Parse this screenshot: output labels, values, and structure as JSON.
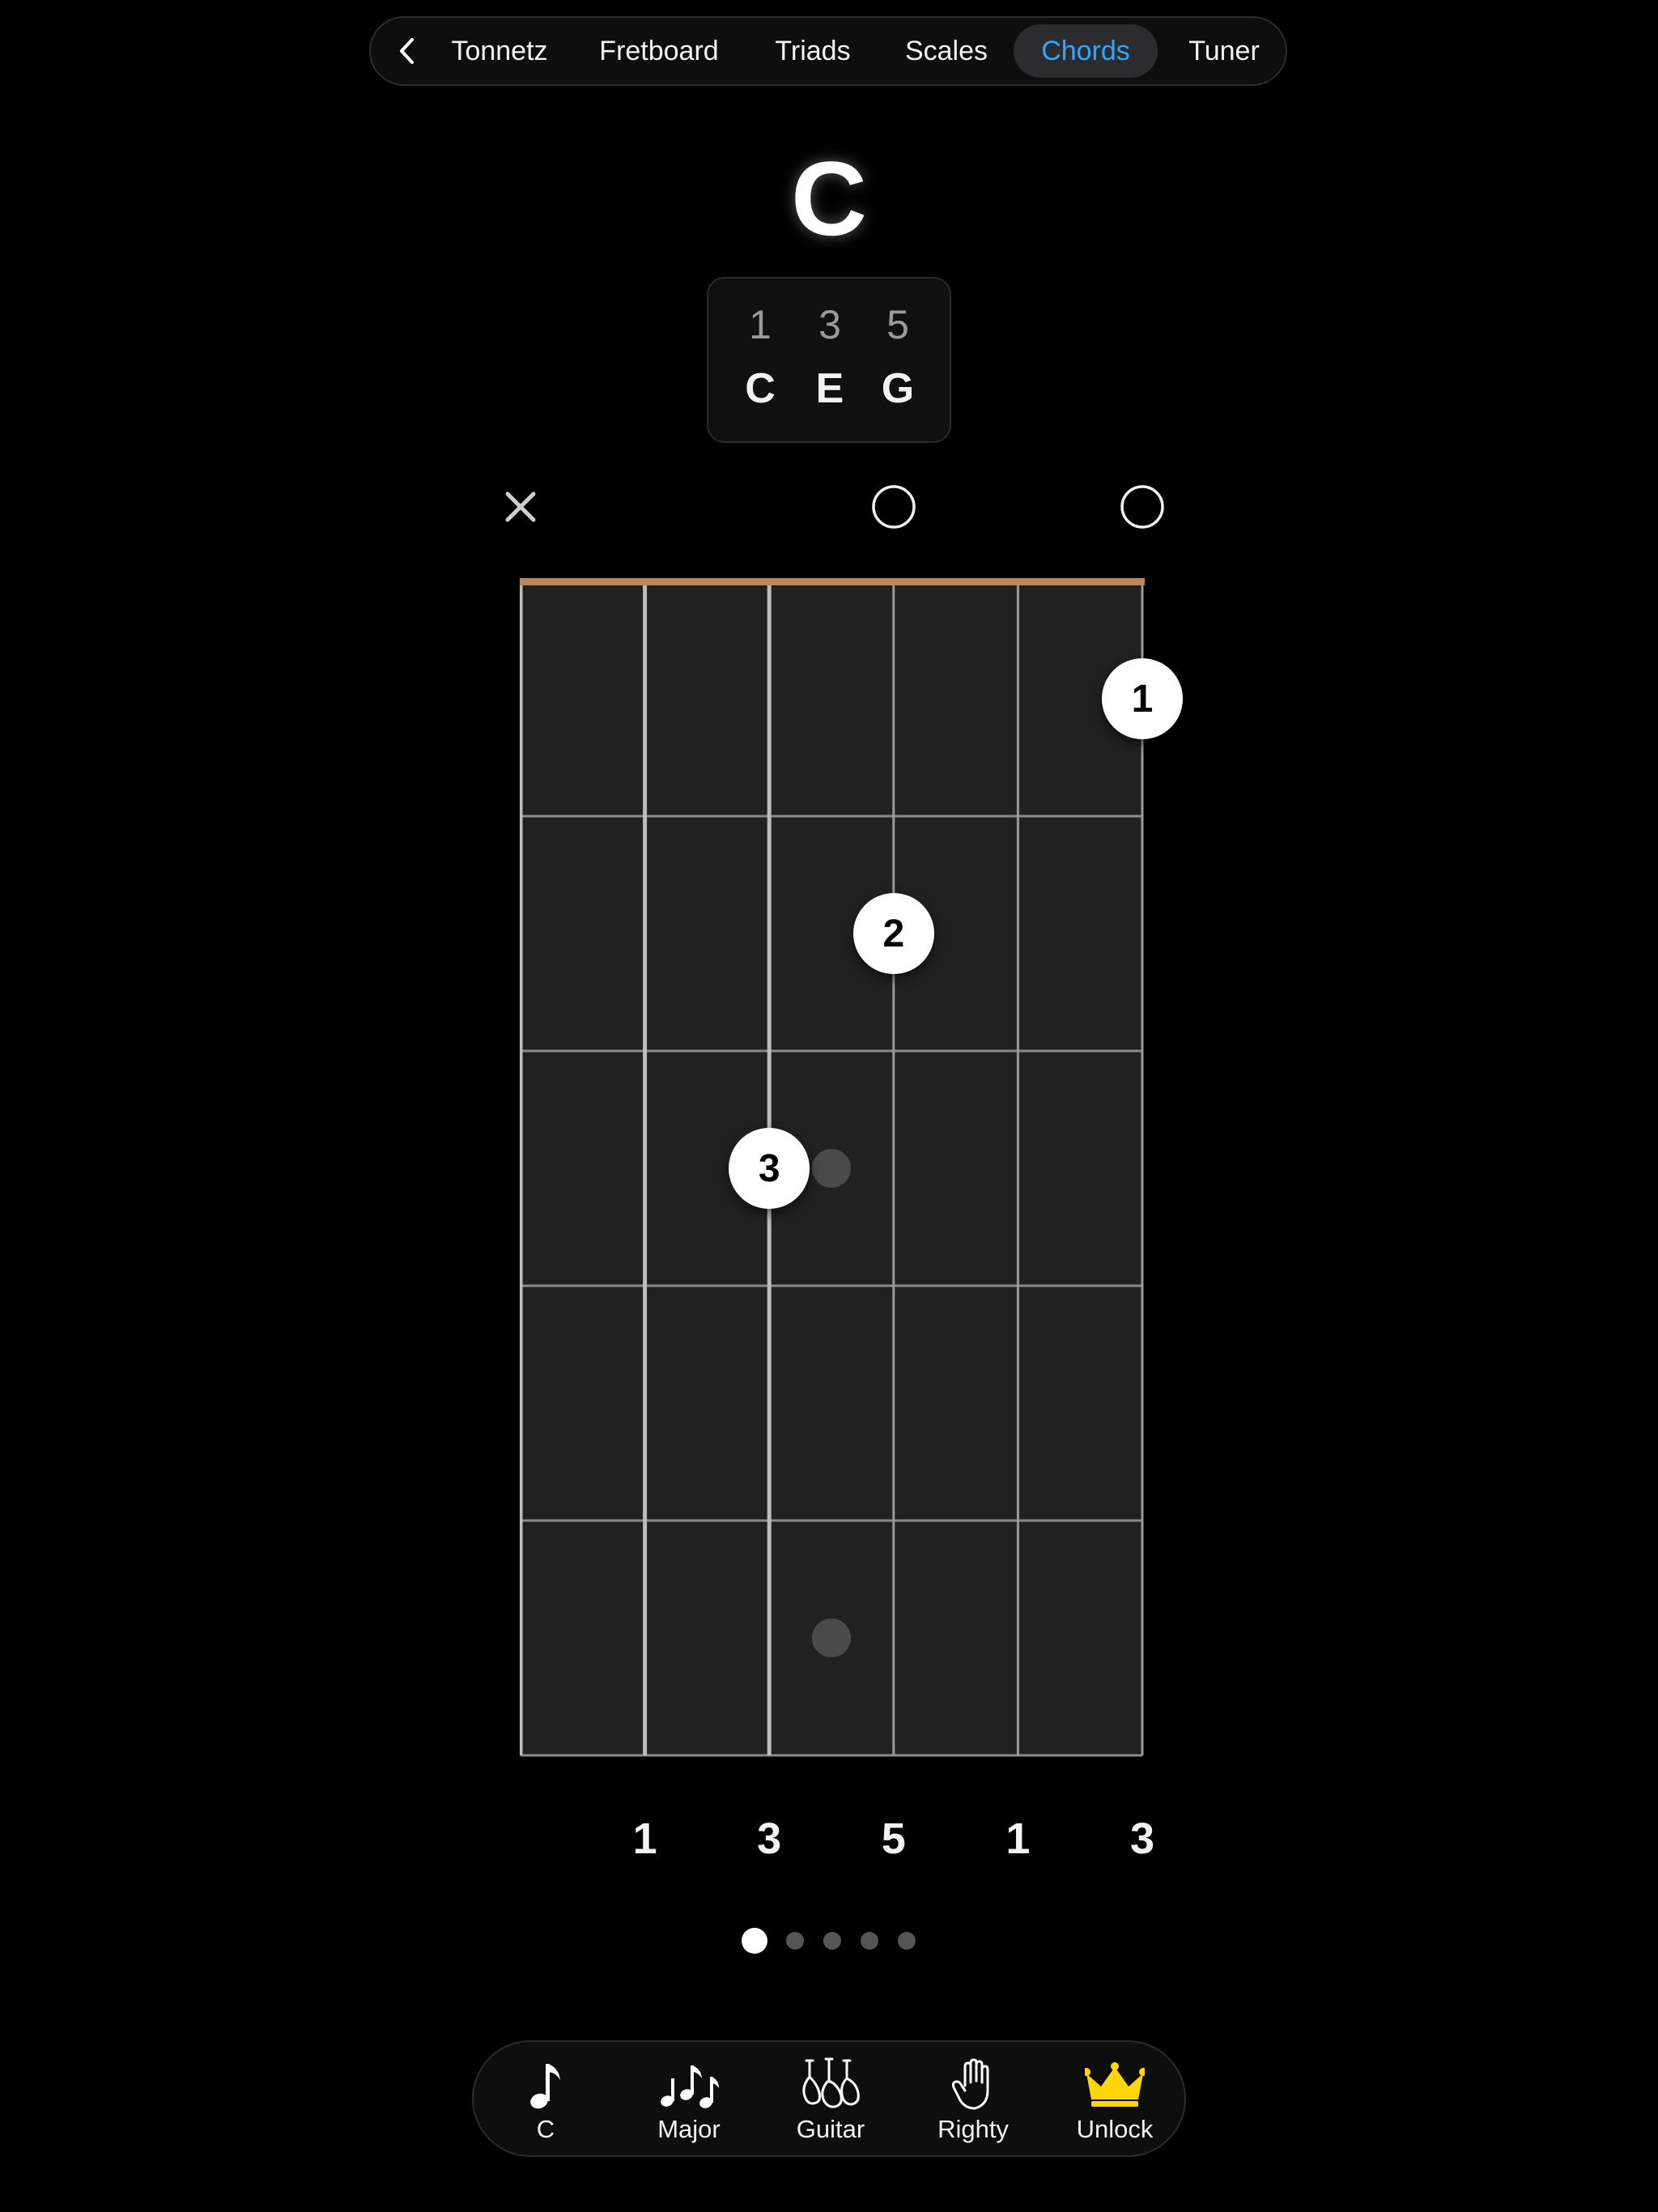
{
  "nav": {
    "tabs": [
      {
        "label": "Tonnetz"
      },
      {
        "label": "Fretboard"
      },
      {
        "label": "Triads"
      },
      {
        "label": "Scales"
      },
      {
        "label": "Chords",
        "active": true
      },
      {
        "label": "Tuner"
      }
    ]
  },
  "chord": {
    "name": "C",
    "intervals": [
      "1",
      "3",
      "5"
    ],
    "notes": [
      "C",
      "E",
      "G"
    ]
  },
  "diagram": {
    "string_states": [
      "muted",
      "fretted",
      "fretted",
      "open",
      "fretted",
      "open"
    ],
    "fingers": [
      {
        "label": "1",
        "string": 5,
        "fret": 1
      },
      {
        "label": "2",
        "string": 3,
        "fret": 2
      },
      {
        "label": "3",
        "string": 2,
        "fret": 3
      }
    ],
    "fret_markers": [
      3,
      5
    ],
    "string_intervals": [
      "",
      "1",
      "3",
      "5",
      "1",
      "3"
    ],
    "accent_color": "#b8875f"
  },
  "pager": {
    "count": 5,
    "active": 0
  },
  "toolbar": {
    "items": [
      {
        "icon": "music-note-icon",
        "label": "C"
      },
      {
        "icon": "music-notes-icon",
        "label": "Major"
      },
      {
        "icon": "guitar-icon",
        "label": "Guitar"
      },
      {
        "icon": "hand-icon",
        "label": "Righty"
      },
      {
        "icon": "crown-icon",
        "label": "Unlock",
        "color": "#ffd60a"
      }
    ]
  },
  "colors": {
    "active_tab": "#2ea8ff",
    "fretboard": "#212121",
    "nut": "#b8875f"
  }
}
